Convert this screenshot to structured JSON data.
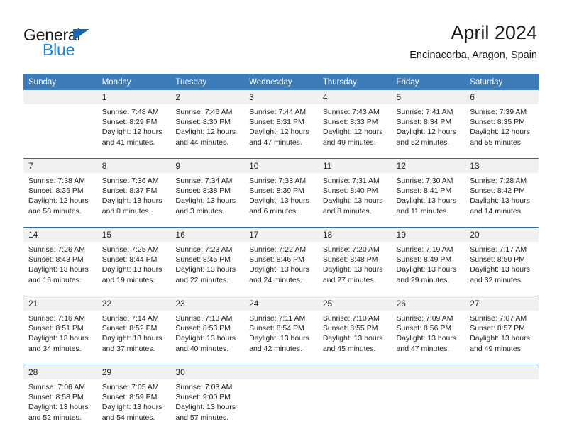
{
  "branding": {
    "name_part1": "General",
    "name_part2": "Blue",
    "logo_icon": "triangle-icon"
  },
  "header": {
    "title": "April 2024",
    "subtitle": "Encinacorba, Aragon, Spain"
  },
  "calendar": {
    "weekday_headers": [
      "Sunday",
      "Monday",
      "Tuesday",
      "Wednesday",
      "Thursday",
      "Friday",
      "Saturday"
    ],
    "header_bg": "#3c7cb8",
    "daynum_bg": "#f1f1f1",
    "week_separator": "#2e6da4",
    "weeks": [
      [
        {
          "day": "",
          "lines": []
        },
        {
          "day": "1",
          "lines": [
            "Sunrise: 7:48 AM",
            "Sunset: 8:29 PM",
            "Daylight: 12 hours",
            "and 41 minutes."
          ]
        },
        {
          "day": "2",
          "lines": [
            "Sunrise: 7:46 AM",
            "Sunset: 8:30 PM",
            "Daylight: 12 hours",
            "and 44 minutes."
          ]
        },
        {
          "day": "3",
          "lines": [
            "Sunrise: 7:44 AM",
            "Sunset: 8:31 PM",
            "Daylight: 12 hours",
            "and 47 minutes."
          ]
        },
        {
          "day": "4",
          "lines": [
            "Sunrise: 7:43 AM",
            "Sunset: 8:33 PM",
            "Daylight: 12 hours",
            "and 49 minutes."
          ]
        },
        {
          "day": "5",
          "lines": [
            "Sunrise: 7:41 AM",
            "Sunset: 8:34 PM",
            "Daylight: 12 hours",
            "and 52 minutes."
          ]
        },
        {
          "day": "6",
          "lines": [
            "Sunrise: 7:39 AM",
            "Sunset: 8:35 PM",
            "Daylight: 12 hours",
            "and 55 minutes."
          ]
        }
      ],
      [
        {
          "day": "7",
          "lines": [
            "Sunrise: 7:38 AM",
            "Sunset: 8:36 PM",
            "Daylight: 12 hours",
            "and 58 minutes."
          ]
        },
        {
          "day": "8",
          "lines": [
            "Sunrise: 7:36 AM",
            "Sunset: 8:37 PM",
            "Daylight: 13 hours",
            "and 0 minutes."
          ]
        },
        {
          "day": "9",
          "lines": [
            "Sunrise: 7:34 AM",
            "Sunset: 8:38 PM",
            "Daylight: 13 hours",
            "and 3 minutes."
          ]
        },
        {
          "day": "10",
          "lines": [
            "Sunrise: 7:33 AM",
            "Sunset: 8:39 PM",
            "Daylight: 13 hours",
            "and 6 minutes."
          ]
        },
        {
          "day": "11",
          "lines": [
            "Sunrise: 7:31 AM",
            "Sunset: 8:40 PM",
            "Daylight: 13 hours",
            "and 8 minutes."
          ]
        },
        {
          "day": "12",
          "lines": [
            "Sunrise: 7:30 AM",
            "Sunset: 8:41 PM",
            "Daylight: 13 hours",
            "and 11 minutes."
          ]
        },
        {
          "day": "13",
          "lines": [
            "Sunrise: 7:28 AM",
            "Sunset: 8:42 PM",
            "Daylight: 13 hours",
            "and 14 minutes."
          ]
        }
      ],
      [
        {
          "day": "14",
          "lines": [
            "Sunrise: 7:26 AM",
            "Sunset: 8:43 PM",
            "Daylight: 13 hours",
            "and 16 minutes."
          ]
        },
        {
          "day": "15",
          "lines": [
            "Sunrise: 7:25 AM",
            "Sunset: 8:44 PM",
            "Daylight: 13 hours",
            "and 19 minutes."
          ]
        },
        {
          "day": "16",
          "lines": [
            "Sunrise: 7:23 AM",
            "Sunset: 8:45 PM",
            "Daylight: 13 hours",
            "and 22 minutes."
          ]
        },
        {
          "day": "17",
          "lines": [
            "Sunrise: 7:22 AM",
            "Sunset: 8:46 PM",
            "Daylight: 13 hours",
            "and 24 minutes."
          ]
        },
        {
          "day": "18",
          "lines": [
            "Sunrise: 7:20 AM",
            "Sunset: 8:48 PM",
            "Daylight: 13 hours",
            "and 27 minutes."
          ]
        },
        {
          "day": "19",
          "lines": [
            "Sunrise: 7:19 AM",
            "Sunset: 8:49 PM",
            "Daylight: 13 hours",
            "and 29 minutes."
          ]
        },
        {
          "day": "20",
          "lines": [
            "Sunrise: 7:17 AM",
            "Sunset: 8:50 PM",
            "Daylight: 13 hours",
            "and 32 minutes."
          ]
        }
      ],
      [
        {
          "day": "21",
          "lines": [
            "Sunrise: 7:16 AM",
            "Sunset: 8:51 PM",
            "Daylight: 13 hours",
            "and 34 minutes."
          ]
        },
        {
          "day": "22",
          "lines": [
            "Sunrise: 7:14 AM",
            "Sunset: 8:52 PM",
            "Daylight: 13 hours",
            "and 37 minutes."
          ]
        },
        {
          "day": "23",
          "lines": [
            "Sunrise: 7:13 AM",
            "Sunset: 8:53 PM",
            "Daylight: 13 hours",
            "and 40 minutes."
          ]
        },
        {
          "day": "24",
          "lines": [
            "Sunrise: 7:11 AM",
            "Sunset: 8:54 PM",
            "Daylight: 13 hours",
            "and 42 minutes."
          ]
        },
        {
          "day": "25",
          "lines": [
            "Sunrise: 7:10 AM",
            "Sunset: 8:55 PM",
            "Daylight: 13 hours",
            "and 45 minutes."
          ]
        },
        {
          "day": "26",
          "lines": [
            "Sunrise: 7:09 AM",
            "Sunset: 8:56 PM",
            "Daylight: 13 hours",
            "and 47 minutes."
          ]
        },
        {
          "day": "27",
          "lines": [
            "Sunrise: 7:07 AM",
            "Sunset: 8:57 PM",
            "Daylight: 13 hours",
            "and 49 minutes."
          ]
        }
      ],
      [
        {
          "day": "28",
          "lines": [
            "Sunrise: 7:06 AM",
            "Sunset: 8:58 PM",
            "Daylight: 13 hours",
            "and 52 minutes."
          ]
        },
        {
          "day": "29",
          "lines": [
            "Sunrise: 7:05 AM",
            "Sunset: 8:59 PM",
            "Daylight: 13 hours",
            "and 54 minutes."
          ]
        },
        {
          "day": "30",
          "lines": [
            "Sunrise: 7:03 AM",
            "Sunset: 9:00 PM",
            "Daylight: 13 hours",
            "and 57 minutes."
          ]
        },
        {
          "day": "",
          "lines": []
        },
        {
          "day": "",
          "lines": []
        },
        {
          "day": "",
          "lines": []
        },
        {
          "day": "",
          "lines": []
        }
      ]
    ]
  }
}
